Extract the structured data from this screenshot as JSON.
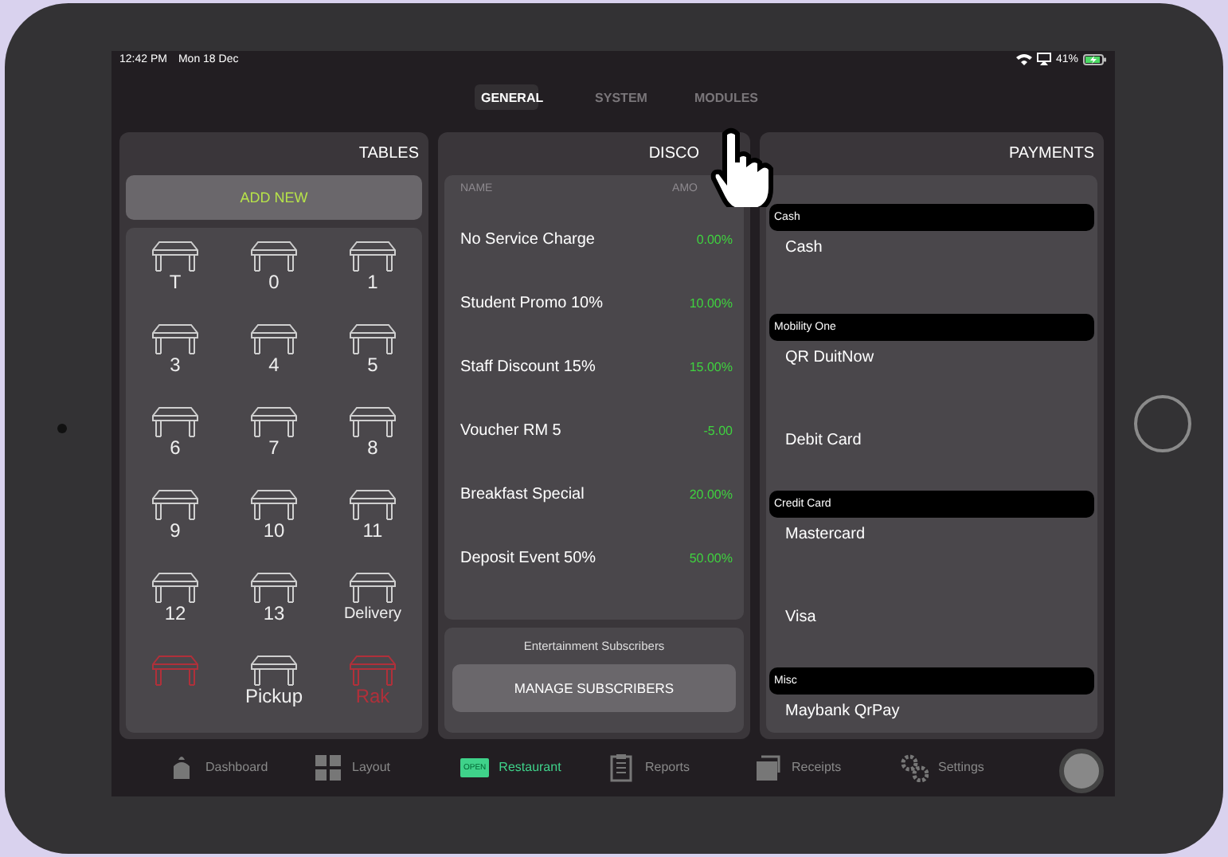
{
  "status_bar": {
    "time": "12:42 PM",
    "date": "Mon 18 Dec",
    "battery": "41%"
  },
  "tabs": [
    {
      "label": "GENERAL",
      "selected": true
    },
    {
      "label": "SYSTEM",
      "selected": false
    },
    {
      "label": "MODULES",
      "selected": false
    }
  ],
  "tables_panel": {
    "title": "TABLES",
    "add_button": "ADD NEW",
    "tables": [
      {
        "label": "T",
        "occupied": false
      },
      {
        "label": "0",
        "occupied": false
      },
      {
        "label": "1",
        "occupied": false
      },
      {
        "label": "3",
        "occupied": false
      },
      {
        "label": "4",
        "occupied": false
      },
      {
        "label": "5",
        "occupied": false
      },
      {
        "label": "6",
        "occupied": false
      },
      {
        "label": "7",
        "occupied": false
      },
      {
        "label": "8",
        "occupied": false
      },
      {
        "label": "9",
        "occupied": false
      },
      {
        "label": "10",
        "occupied": false
      },
      {
        "label": "11",
        "occupied": false
      },
      {
        "label": "12",
        "occupied": false
      },
      {
        "label": "13",
        "occupied": false
      },
      {
        "label": "Delivery",
        "occupied": false
      },
      {
        "occupied": true
      },
      {
        "label": "Pickup",
        "occupied": false
      },
      {
        "label": "Rak",
        "occupied": true
      }
    ]
  },
  "discounts_panel": {
    "title": "DISCO",
    "columns": [
      "NAME",
      "AMO"
    ],
    "rows": [
      {
        "name": "No Service Charge",
        "amount": "0.00%"
      },
      {
        "name": "Student Promo 10%",
        "amount": "10.00%"
      },
      {
        "name": "Staff Discount 15%",
        "amount": "15.00%"
      },
      {
        "name": "Voucher RM 5",
        "amount": "-5.00"
      },
      {
        "name": "Breakfast Special",
        "amount": "20.00%"
      },
      {
        "name": "Deposit Event 50%",
        "amount": "50.00%"
      }
    ],
    "subscribers_label": "Entertainment Subscribers",
    "manage_button": "MANAGE SUBSCRIBERS"
  },
  "payments_panel": {
    "title": "PAYMENTS",
    "groups": [
      {
        "name": "Cash",
        "methods": [
          "Cash"
        ]
      },
      {
        "name": "Mobility One",
        "methods": [
          "QR DuitNow",
          "Debit Card"
        ]
      },
      {
        "name": "Credit Card",
        "methods": [
          "Mastercard",
          "Visa"
        ]
      },
      {
        "name": "Misc",
        "methods": [
          "Maybank QrPay"
        ]
      }
    ]
  },
  "nav": [
    {
      "label": "Dashboard",
      "kind": "dashboard",
      "selected": false
    },
    {
      "label": "Layout",
      "kind": "layout",
      "selected": false
    },
    {
      "label": "Restaurant",
      "kind": "restaurant",
      "badge": "OPEN",
      "selected": true
    },
    {
      "label": "Reports",
      "kind": "reports",
      "selected": false
    },
    {
      "label": "Receipts",
      "kind": "receipts",
      "selected": false
    },
    {
      "label": "Settings",
      "kind": "settings",
      "selected": false
    }
  ]
}
